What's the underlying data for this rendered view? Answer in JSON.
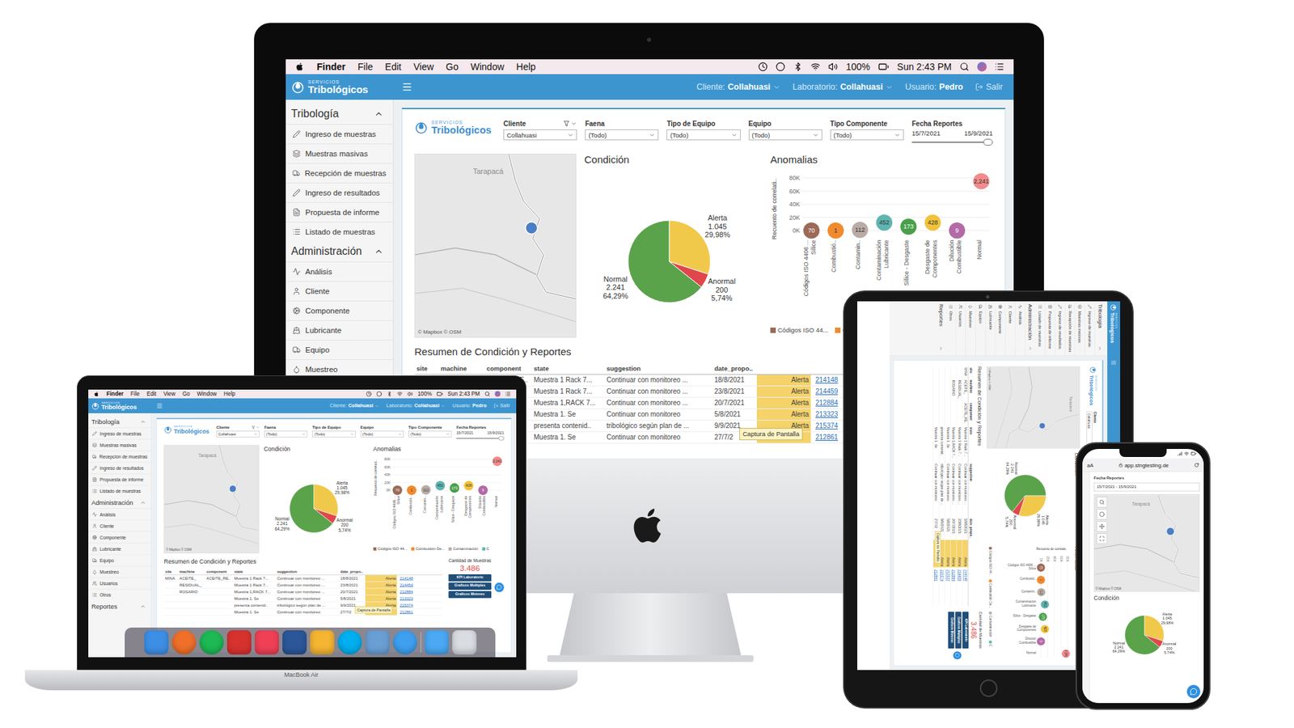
{
  "mac_menubar": {
    "app": "Finder",
    "menus": [
      "File",
      "Edit",
      "View",
      "Go",
      "Window",
      "Help"
    ],
    "battery": "100%",
    "clock": "Sun 2:43 PM"
  },
  "brand": {
    "small": "SERVICIOS",
    "name": "Tribológicos"
  },
  "header": {
    "items": [
      {
        "label": "Cliente:",
        "value": "Collahuasi",
        "has_menu": true
      },
      {
        "label": "Laboratorio:",
        "value": "Collahuasi",
        "has_menu": true
      },
      {
        "label": "Usuario:",
        "value": "Pedro",
        "has_menu": false
      }
    ],
    "logout": "Salir"
  },
  "sidebar": [
    {
      "title": "Tribología",
      "expanded": true,
      "items": [
        {
          "label": "Ingreso de muestras",
          "selected": false
        },
        {
          "label": "Muestras masivas",
          "selected": false
        },
        {
          "label": "Recepción de muestras",
          "selected": false
        },
        {
          "label": "Ingreso de resultados",
          "selected": false
        },
        {
          "label": "Propuesta de informe",
          "selected": false
        },
        {
          "label": "Listado de muestras",
          "selected": false
        }
      ]
    },
    {
      "title": "Administración",
      "expanded": true,
      "items": [
        {
          "label": "Análisis",
          "selected": false
        },
        {
          "label": "Cliente",
          "selected": false
        },
        {
          "label": "Componente",
          "selected": false
        },
        {
          "label": "Lubricante",
          "selected": false
        },
        {
          "label": "Equipo",
          "selected": false
        },
        {
          "label": "Muestreo",
          "selected": false
        },
        {
          "label": "Usuarios",
          "selected": false
        },
        {
          "label": "Otros",
          "selected": false
        }
      ]
    },
    {
      "title": "Reportes",
      "expanded": true,
      "items": []
    }
  ],
  "filters": [
    {
      "label": "Cliente",
      "value": "Collahuasi",
      "has_filter": true
    },
    {
      "label": "Faena",
      "value": "(Todo)",
      "has_filter": false
    },
    {
      "label": "Tipo de Equipo",
      "value": "(Todo)",
      "has_filter": false
    },
    {
      "label": "Equipo",
      "value": "(Todo)",
      "has_filter": false
    },
    {
      "label": "Tipo Componente",
      "value": "(Todo)",
      "has_filter": false
    }
  ],
  "date_filter": {
    "label": "Fecha Reportes",
    "from": "15/7/2021",
    "to": "15/9/2021",
    "level": 1
  },
  "map": {
    "region": "Tarapacá",
    "credit": "© Mapbox © OSM"
  },
  "condition": {
    "title": "Condición",
    "slices": [
      {
        "label": "Alerta",
        "count": "1.045",
        "share": "29,98%",
        "value": 1045,
        "color": "#f1c94a"
      },
      {
        "label": "Anormal",
        "count": "200",
        "share": "5,74%",
        "value": 200,
        "color": "#e0474c"
      },
      {
        "label": "Normal",
        "count": "2.241",
        "share": "64,29%",
        "value": 2241,
        "color": "#5aa34a"
      }
    ]
  },
  "anomalies": {
    "title": "Anomalias",
    "axis_label": "Recuento de correlati..",
    "ticks": [
      "80K",
      "60K",
      "40K",
      "20K",
      "0K"
    ],
    "axis_max": 80000,
    "points": [
      {
        "label": [
          "Códigos ISO 4406 ...",
          "Sílice"
        ],
        "count": "70",
        "value": 0,
        "color": "#9b6a58"
      },
      {
        "label": [
          "Combustió.."
        ],
        "count": "1",
        "value": 0,
        "color": "#f08a2e"
      },
      {
        "label": [
          "Contamin.."
        ],
        "count": "112",
        "value": 1000,
        "color": "#b9aba6"
      },
      {
        "label": [
          "Contaminación",
          "Lubricante"
        ],
        "count": "452",
        "value": 12000,
        "color": "#5fb5b0"
      },
      {
        "label": [
          "Sílice - Desgaste"
        ],
        "count": "173",
        "value": 6000,
        "color": "#4aa04a"
      },
      {
        "label": [
          "Desgaste de",
          "Componentes"
        ],
        "count": "428",
        "value": 12000,
        "color": "#f2c23c"
      },
      {
        "label": [
          "Dilución",
          "Combustible"
        ],
        "count": "9",
        "value": 0,
        "color": "#b36aa7"
      },
      {
        "label": [
          "Normal"
        ],
        "count": "2,241",
        "value": 75000,
        "color": "#f28b8b"
      }
    ],
    "legend": [
      {
        "label": "Códigos ISO 44...",
        "color": "#9b6a58"
      },
      {
        "label": "Combustión De...",
        "color": "#f08a2e"
      },
      {
        "label": "Contaminación",
        "color": "#b9aba6"
      },
      {
        "label": "C",
        "color": "#5fb5b0"
      }
    ]
  },
  "summary": {
    "title": "Resumen de Condición y Reportes",
    "columns": [
      {
        "label": "site",
        "kind": "text"
      },
      {
        "label": "machine",
        "kind": "text"
      },
      {
        "label": "component",
        "kind": "text"
      },
      {
        "label": "state",
        "kind": "text"
      },
      {
        "label": "suggestion",
        "kind": "text"
      },
      {
        "label": "date_propo..",
        "kind": "text"
      },
      {
        "label": "",
        "kind": "status"
      },
      {
        "label": "",
        "kind": "link"
      }
    ],
    "rows": [
      [
        "MINA",
        "ACEITE_",
        "ACEITE_RE..",
        "Muestra 1 Rack 7...",
        "Continuar con monitoreo ...",
        "18/8/2021",
        "Alerta",
        "214148"
      ],
      [
        "",
        "RESIDUAL_",
        "",
        "Muestra 1 Rack 7...",
        "Continuar con monitoreo ...",
        "23/8/2021",
        "Alerta",
        "214459"
      ],
      [
        "",
        "ROSARIO",
        "",
        "Muestra 1,RACK 7...",
        "Continuar con monitoreo ...",
        "20/7/2021",
        "Alerta",
        "212884"
      ],
      [
        "",
        "",
        "",
        "Muestra 1. Se",
        "Continuar con monitoreo",
        "5/8/2021",
        "Alerta",
        "213323"
      ],
      [
        "",
        "",
        "",
        "presenta contenid..",
        "tribológico según plan de ...",
        "9/9/2021",
        "Alerta",
        "215374"
      ],
      [
        "",
        "",
        "",
        "Muestra 1. Se",
        "Continuar con monitoreo",
        "27/7/2",
        "",
        "212861"
      ]
    ]
  },
  "samples": {
    "title": "Cantidad de Muestras",
    "count": "3.486",
    "buttons": [
      "KPI Laboratorio",
      "Graficos Multiples",
      "Graficos Motores"
    ]
  },
  "tooltip": "Captura de Pantalla",
  "laptop": {
    "label": "MacBook Air"
  },
  "phone": {
    "text_size": "aA",
    "url": "app.stngtesting.de",
    "filter_label": "Fecha Reportes",
    "filter_value": "15/7/2021 - 15/9/2021"
  }
}
